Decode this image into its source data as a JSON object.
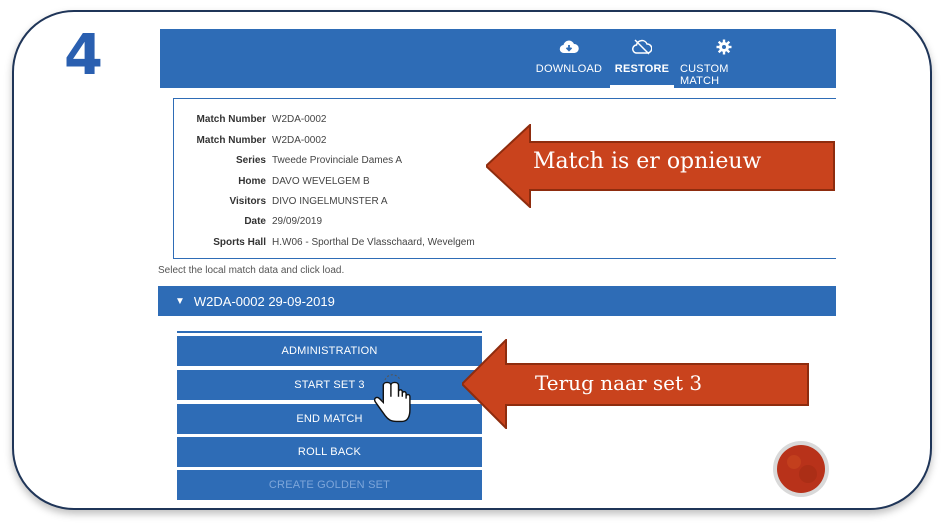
{
  "slide": {
    "step_number": "4"
  },
  "header": {
    "tabs": [
      {
        "label": "DOWNLOAD",
        "icon": "cloud-download-icon",
        "active": false
      },
      {
        "label": "RESTORE",
        "icon": "cloud-off-icon",
        "active": true
      },
      {
        "label": "CUSTOM MATCH",
        "icon": "gear-icon",
        "active": false
      }
    ]
  },
  "match_info": {
    "rows": [
      {
        "key": "Match Number",
        "value": "W2DA-0002"
      },
      {
        "key": "Match Number",
        "value": "W2DA-0002"
      },
      {
        "key": "Series",
        "value": "Tweede Provinciale Dames A"
      },
      {
        "key": "Home",
        "value": "DAVO WEVELGEM B"
      },
      {
        "key": "Visitors",
        "value": "DIVO INGELMUNSTER A"
      },
      {
        "key": "Date",
        "value": "29/09/2019"
      },
      {
        "key": "Sports Hall",
        "value": "H.W06 - Sporthal De Vlasschaard, Wevelgem"
      }
    ]
  },
  "hint": "Select the local match data and click load.",
  "match_entry": {
    "label": "W2DA-0002 29-09-2019"
  },
  "actions": [
    {
      "label": "ADMINISTRATION",
      "enabled": true
    },
    {
      "label": "START SET 3",
      "enabled": true
    },
    {
      "label": "END MATCH",
      "enabled": true
    },
    {
      "label": "ROLL BACK",
      "enabled": true
    },
    {
      "label": "CREATE GOLDEN SET",
      "enabled": false
    }
  ],
  "callouts": {
    "match_restored": "Match is er opnieuw",
    "back_to_set": "Terug naar set 3"
  },
  "colors": {
    "app_blue": "#2e6cb6",
    "callout_fill": "#c9431d",
    "callout_border": "#8e2c0e",
    "frame_border": "#1f3558",
    "step_number": "#2a5fb0"
  }
}
